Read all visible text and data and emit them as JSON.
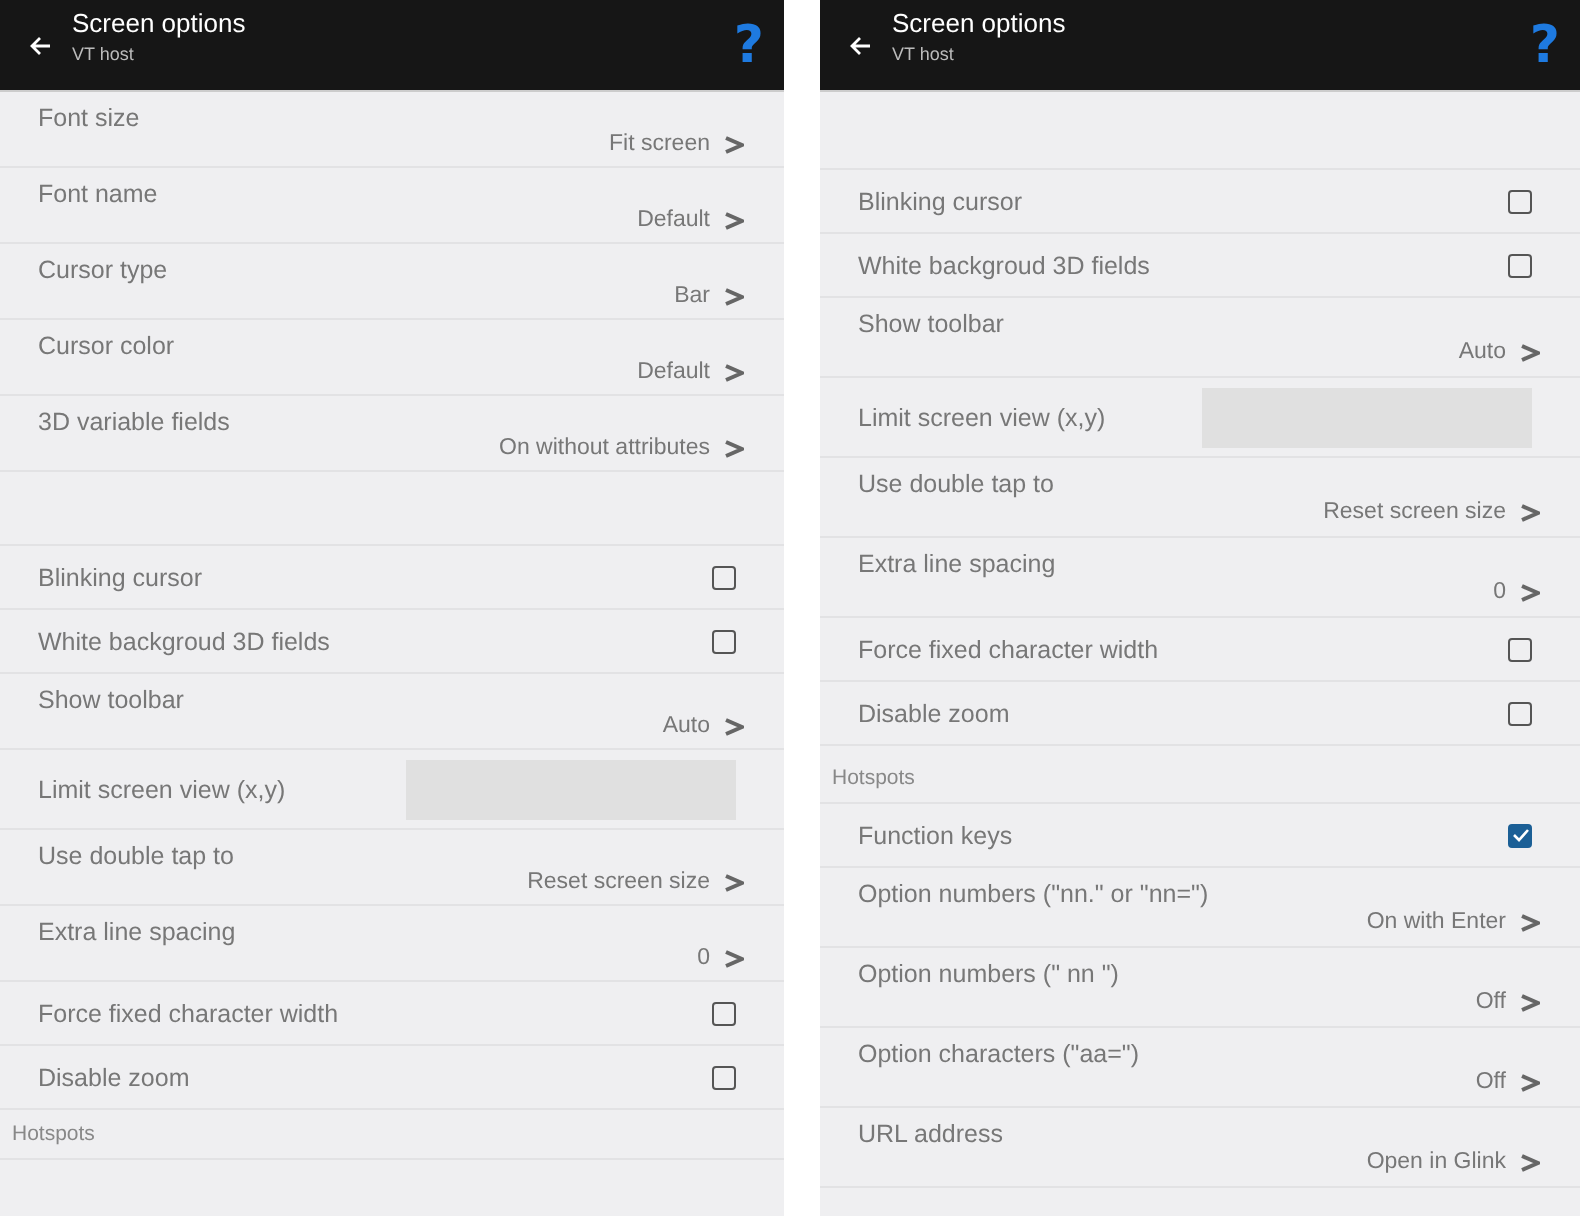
{
  "screens": [
    {
      "title": "Screen options",
      "subtitle": "VT host",
      "help": "?",
      "items": [
        {
          "kind": "value",
          "label": "Font size",
          "value": "Fit screen"
        },
        {
          "kind": "value",
          "label": "Font name",
          "value": "Default"
        },
        {
          "kind": "value",
          "label": "Cursor type",
          "value": "Bar"
        },
        {
          "kind": "value",
          "label": "Cursor color",
          "value": "Default"
        },
        {
          "kind": "value",
          "label": "3D variable fields",
          "value": "On without attributes"
        },
        {
          "kind": "spacer"
        },
        {
          "kind": "checkbox",
          "label": "Blinking cursor",
          "checked": false
        },
        {
          "kind": "checkbox",
          "label": "White backgroud 3D fields",
          "checked": false
        },
        {
          "kind": "value",
          "label": "Show toolbar",
          "value": "Auto"
        },
        {
          "kind": "field",
          "label": "Limit screen view (x,y)"
        },
        {
          "kind": "value",
          "label": "Use double tap to",
          "value": "Reset screen size"
        },
        {
          "kind": "value",
          "label": "Extra  line spacing",
          "value": "0"
        },
        {
          "kind": "checkbox",
          "label": "Force fixed character width",
          "checked": false
        },
        {
          "kind": "checkbox",
          "label": "Disable zoom",
          "checked": false
        },
        {
          "kind": "section",
          "label": "Hotspots"
        }
      ]
    },
    {
      "title": "Screen options",
      "subtitle": "VT host",
      "help": "?",
      "items": [
        {
          "kind": "spacer"
        },
        {
          "kind": "checkbox",
          "label": "Blinking cursor",
          "checked": false
        },
        {
          "kind": "checkbox",
          "label": "White backgroud 3D fields",
          "checked": false
        },
        {
          "kind": "value",
          "label": "Show toolbar",
          "value": "Auto"
        },
        {
          "kind": "field",
          "label": "Limit screen view (x,y)"
        },
        {
          "kind": "value",
          "label": "Use double tap to",
          "value": "Reset screen size"
        },
        {
          "kind": "value",
          "label": "Extra  line spacing",
          "value": "0"
        },
        {
          "kind": "checkbox",
          "label": "Force fixed character width",
          "checked": false
        },
        {
          "kind": "checkbox",
          "label": "Disable zoom",
          "checked": false
        },
        {
          "kind": "section",
          "label": "Hotspots"
        },
        {
          "kind": "checkbox",
          "label": "Function keys",
          "checked": true
        },
        {
          "kind": "value",
          "label": "Option numbers (\"nn.\" or \"nn=\")",
          "value": "On with Enter"
        },
        {
          "kind": "value",
          "label": "Option numbers (\" nn \")",
          "value": "Off"
        },
        {
          "kind": "value",
          "label": "Option characters (\"aa=\")",
          "value": "Off"
        },
        {
          "kind": "value",
          "label": "URL address",
          "value": "Open in Glink"
        }
      ]
    }
  ]
}
